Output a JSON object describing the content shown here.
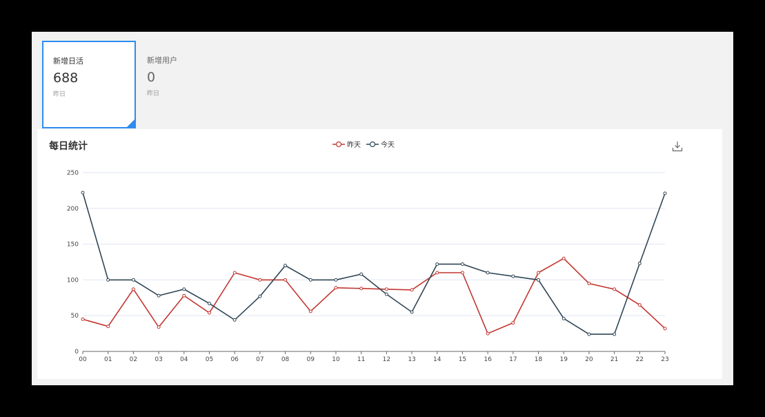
{
  "tabs": [
    {
      "title": "新增日活",
      "value": "688",
      "sub": "昨日",
      "active": true
    },
    {
      "title": "新增用户",
      "value": "0",
      "sub": "昨日",
      "active": false
    }
  ],
  "chart_title": "每日统计",
  "icons": {
    "download": "download-icon"
  },
  "colors": {
    "accent": "#2d8cf0",
    "yesterday": "#c23531",
    "today": "#2f4554"
  },
  "chart_data": {
    "type": "line",
    "title": "每日统计",
    "xlabel": "",
    "ylabel": "",
    "categories": [
      "00",
      "01",
      "02",
      "03",
      "04",
      "05",
      "06",
      "07",
      "08",
      "09",
      "10",
      "11",
      "12",
      "13",
      "14",
      "15",
      "16",
      "17",
      "18",
      "19",
      "20",
      "21",
      "22",
      "23"
    ],
    "ylim": [
      0,
      250
    ],
    "yticks": [
      0,
      50,
      100,
      150,
      200,
      250
    ],
    "grid": true,
    "legend": "top-center",
    "series": [
      {
        "name": "昨天",
        "color": "#c23531",
        "values": [
          45,
          35,
          87,
          34,
          78,
          54,
          110,
          100,
          100,
          56,
          89,
          88,
          87,
          86,
          110,
          110,
          25,
          40,
          110,
          130,
          95,
          87,
          65,
          32
        ]
      },
      {
        "name": "今天",
        "color": "#2f4554",
        "values": [
          222,
          100,
          100,
          78,
          87,
          67,
          44,
          77,
          120,
          100,
          100,
          108,
          80,
          55,
          122,
          122,
          110,
          105,
          100,
          46,
          24,
          24,
          123,
          221
        ]
      }
    ]
  }
}
